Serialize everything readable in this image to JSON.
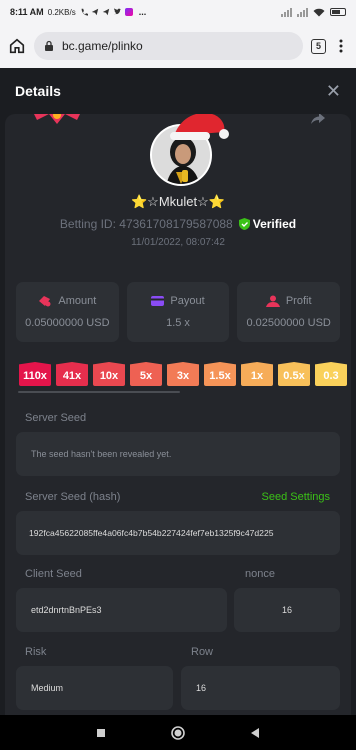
{
  "status": {
    "time": "8:11 AM",
    "speed": "0.2KB/s",
    "more": "...",
    "wifi_icon": "wifi-icon",
    "signal_icon": "signal-icon",
    "battery_icon": "battery-icon"
  },
  "browser": {
    "url": "bc.game/plinko",
    "tabs": "5",
    "home_icon": "home-icon",
    "lock_icon": "lock-icon",
    "menu_icon": "more-vertical-icon"
  },
  "header": {
    "title": "Details",
    "close_icon": "close-icon"
  },
  "bet": {
    "username": "⭐☆Mkulet☆⭐",
    "betting_id": "Betting ID: 47361708179587088",
    "verified": "Verified",
    "date": "11/01/2022, 08:07:42"
  },
  "stats": [
    {
      "label": "Amount",
      "value": "0.05000000 USD"
    },
    {
      "label": "Payout",
      "value": "1.5 x"
    },
    {
      "label": "Profit",
      "value": "0.02500000 USD"
    }
  ],
  "multipliers": [
    {
      "label": "110x",
      "color": "#e4154b"
    },
    {
      "label": "41x",
      "color": "#e62e4d"
    },
    {
      "label": "10x",
      "color": "#ea4850"
    },
    {
      "label": "5x",
      "color": "#ee6153"
    },
    {
      "label": "3x",
      "color": "#f27b56"
    },
    {
      "label": "1.5x",
      "color": "#f59458"
    },
    {
      "label": "1x",
      "color": "#f6ac59"
    },
    {
      "label": "0.5x",
      "color": "#f8c05a"
    },
    {
      "label": "0.3",
      "color": "#fad15b"
    }
  ],
  "fields": {
    "server_seed_label": "Server Seed",
    "server_seed_value": "The seed hasn't been revealed yet.",
    "server_seed_hash_label": "Server Seed (hash)",
    "seed_settings": "Seed Settings",
    "server_seed_hash_value": "192fca45622085ffe4a06fc4b7b54b227424fef7eb1325f9c47d225",
    "client_seed_label": "Client Seed",
    "client_seed_value": "etd2dnrtnBnPEs3",
    "nonce_label": "nonce",
    "nonce_value": "16",
    "risk_label": "Risk",
    "risk_value": "Medium",
    "row_label": "Row",
    "row_value": "16"
  },
  "colors": {
    "background": "#24262b",
    "card": "#2d3035",
    "accent_green": "#3bc117"
  }
}
